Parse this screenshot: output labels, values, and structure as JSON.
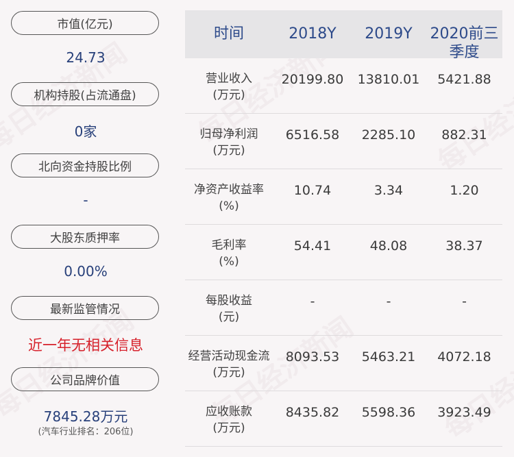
{
  "left_panel": {
    "items": [
      {
        "label": "市值(亿元)",
        "value": "24.73"
      },
      {
        "label": "机构持股(占流通盘)",
        "value": "0家"
      },
      {
        "label": "北向资金持股比例",
        "value": "-"
      },
      {
        "label": "大股东质押率",
        "value": "0.00%"
      },
      {
        "label": "最新监管情况",
        "value": "近一年无相关信息"
      },
      {
        "label": "公司品牌价值",
        "value": "7845.28万元",
        "sub": "(汽车行业排名：206位)"
      }
    ]
  },
  "table": {
    "headers": [
      "时间",
      "2018Y",
      "2019Y",
      "2020前三季度"
    ],
    "rows": [
      {
        "label_line1": "营业收入",
        "label_line2": "(万元)",
        "values": [
          "20199.80",
          "13810.01",
          "5421.88"
        ]
      },
      {
        "label_line1": "归母净利润",
        "label_line2": "(万元)",
        "values": [
          "6516.58",
          "2285.10",
          "882.31"
        ]
      },
      {
        "label_line1": "净资产收益率",
        "label_line2": "(%)",
        "values": [
          "10.74",
          "3.34",
          "1.20"
        ]
      },
      {
        "label_line1": "毛利率",
        "label_line2": "(%)",
        "values": [
          "54.41",
          "48.08",
          "38.37"
        ]
      },
      {
        "label_line1": "每股收益",
        "label_line2": "(元)",
        "values": [
          "-",
          "-",
          "-"
        ]
      },
      {
        "label_line1": "经营活动现金流",
        "label_line2": "(万元)",
        "values": [
          "8093.53",
          "5463.21",
          "4072.18"
        ]
      },
      {
        "label_line1": "应收账款",
        "label_line2": "(万元)",
        "values": [
          "8435.82",
          "5598.36",
          "3923.49"
        ]
      }
    ]
  },
  "watermark": "每日经济新闻",
  "colors": {
    "value_blue": "#28407a",
    "header_blue": "#2d4a8a",
    "alert_red": "#d6202a",
    "header_bg": "#e6e5e7",
    "page_bg": "#f8f5f6"
  }
}
